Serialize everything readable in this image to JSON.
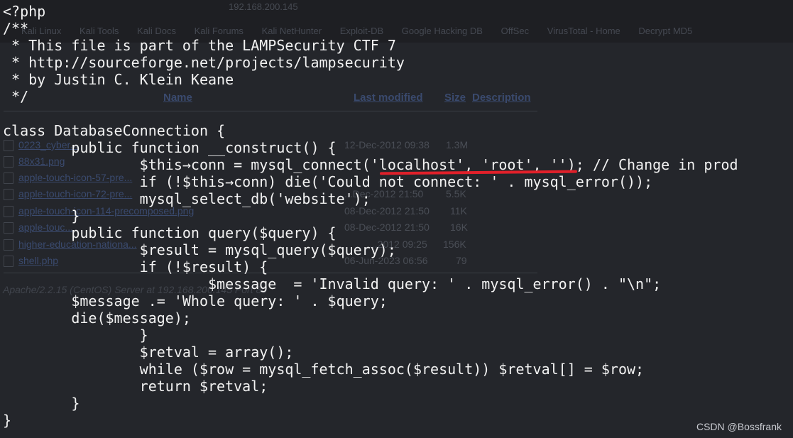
{
  "background": {
    "url": "192.168.200.145",
    "bookmarks": [
      "Kali Linux",
      "Kali Tools",
      "Kali Docs",
      "Kali Forums",
      "Kali NetHunter",
      "Exploit-DB",
      "Google Hacking DB",
      "OffSec",
      "VirusTotal - Home",
      "Decrypt MD5"
    ],
    "columns": {
      "name": "Name",
      "modified": "Last modified",
      "size": "Size",
      "description": "Description"
    },
    "files": [
      {
        "name": "0223_cyber...",
        "modified": "12-Dec-2012 09:38",
        "size": "1.3M"
      },
      {
        "name": "88x31.png",
        "modified": "",
        "size": ""
      },
      {
        "name": "apple-touch-icon-57-pre...",
        "modified": "",
        "size": ""
      },
      {
        "name": "apple-touch-icon-72-pre...",
        "modified": "...Dec-2012 21:50",
        "size": "5.5K"
      },
      {
        "name": "apple-touch-icon-114-precomposed.png",
        "modified": "08-Dec-2012 21:50",
        "size": "11K"
      },
      {
        "name": "apple-touc...",
        "modified": "08-Dec-2012 21:50",
        "size": "16K"
      },
      {
        "name": "higher-education-nationa...",
        "modified": "...2012 09:25",
        "size": "156K"
      },
      {
        "name": "shell.php",
        "modified": "06-Jun-2023 06:56",
        "size": "79"
      }
    ],
    "footer": "Apache/2.2.15 (CentOS) Server at 192.168.200.145 Port 80"
  },
  "code_lines": [
    "<?php",
    "/**",
    " * This file is part of the LAMPSecurity CTF 7",
    " * http://sourceforge.net/projects/lampsecurity",
    " * by Justin C. Klein Keane",
    " */",
    "",
    "class DatabaseConnection {",
    "        public function __construct() {",
    "                $this→conn = mysql_connect('localhost', 'root', ''); // Change in prod",
    "                if (!$this→conn) die('Could not connect: ' . mysql_error());",
    "                mysql_select_db('website');",
    "        }",
    "        public function query($query) {",
    "                $result = mysql_query($query);",
    "                if (!$result) {",
    "                        $message  = 'Invalid query: ' . mysql_error() . \"\\n\";",
    "        $message .= 'Whole query: ' . $query;",
    "        die($message);",
    "                }",
    "                $retval = array();",
    "                while ($row = mysql_fetch_assoc($result)) $retval[] = $row;",
    "                return $retval;",
    "        }",
    "}"
  ],
  "highlight_color": "#e0202a",
  "watermark": "CSDN @Bossfrank"
}
